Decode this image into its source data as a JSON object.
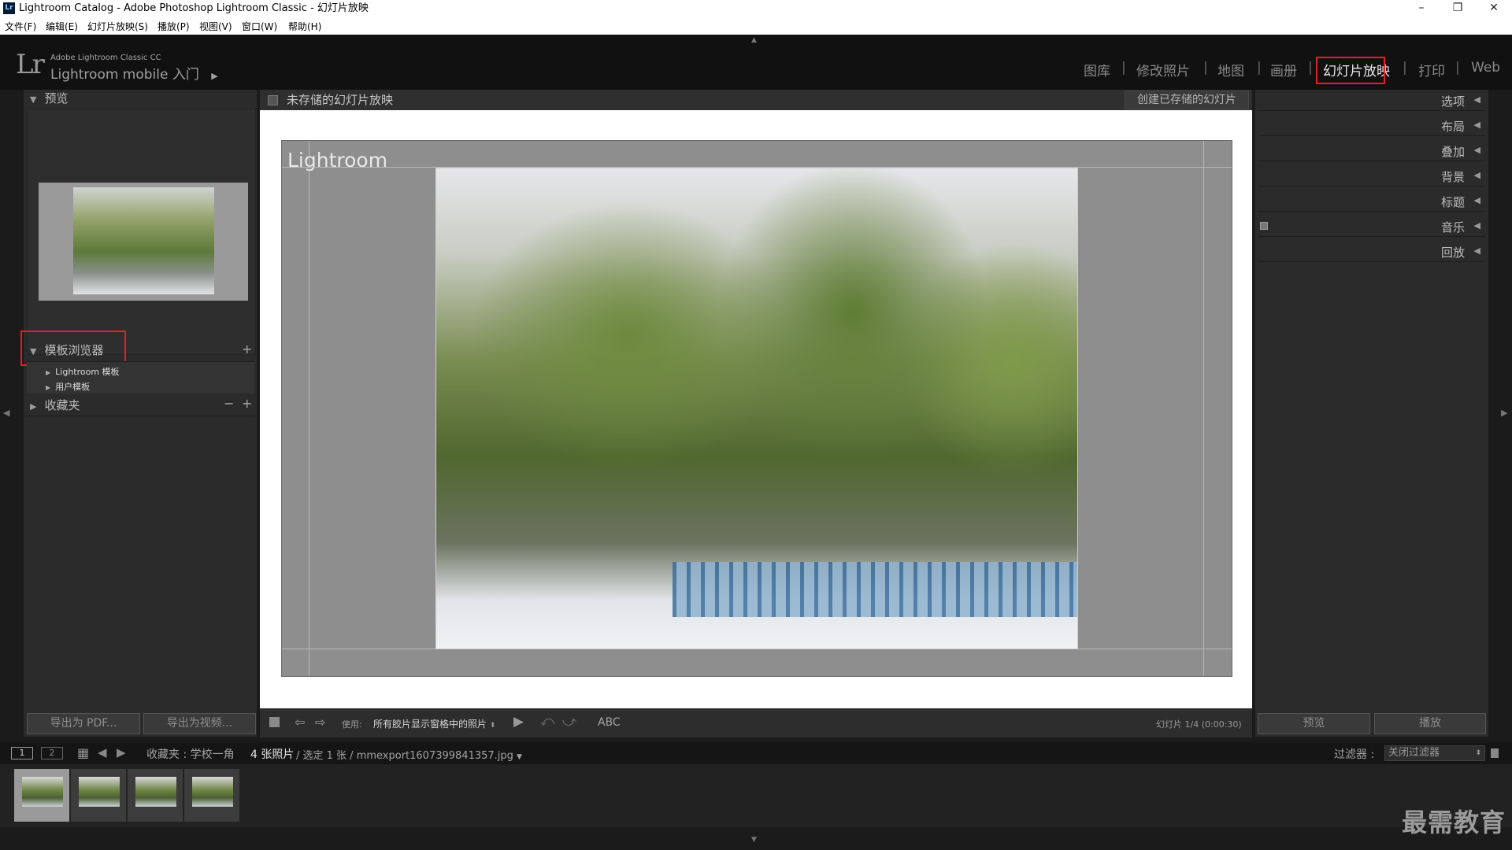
{
  "window": {
    "app_badge": "Lr",
    "title": "Lightroom Catalog - Adobe Photoshop Lightroom Classic - 幻灯片放映",
    "minimize": "–",
    "restore": "❐",
    "close": "✕"
  },
  "menu": [
    "文件(F)",
    "编辑(E)",
    "幻灯片放映(S)",
    "播放(P)",
    "视图(V)",
    "窗口(W)",
    "帮助(H)"
  ],
  "brand": {
    "logo": "Lr",
    "small": "Adobe Lightroom Classic CC",
    "mobile": "Lightroom mobile 入门",
    "arrow": "▶"
  },
  "modules": {
    "items": [
      "图库",
      "修改照片",
      "地图",
      "画册",
      "幻灯片放映",
      "打印",
      "Web"
    ],
    "active": "幻灯片放映",
    "separator": "|"
  },
  "left_panel": {
    "preview_title": "预览",
    "template_browser_title": "模板浏览器",
    "template_items": [
      "Lightroom 模板",
      "用户模板"
    ],
    "collections_title": "收藏夹",
    "add": "+",
    "minus": "−",
    "plus": "+",
    "export_pdf": "导出为 PDF...",
    "export_video": "导出为视频..."
  },
  "center": {
    "slideshow_title": "未存储的幻灯片放映",
    "create_saved": "创建已存储的幻灯片",
    "slide_identity_text": "Lightroom",
    "use_label": "使用:",
    "use_value": "所有胶片显示窗格中的照片",
    "abc": "ABC",
    "slide_counter": "幻灯片 1/4 (0:00:30)"
  },
  "right_panel": {
    "sections": [
      "选项",
      "布局",
      "叠加",
      "背景",
      "标题",
      "音乐",
      "回放"
    ],
    "preview_btn": "预览",
    "play_btn": "播放"
  },
  "filmbar": {
    "page1": "1",
    "page2": "2",
    "collection": "收藏夹 : 学校一角",
    "count": "4 张照片",
    "selection": "/ 选定 1 张 / mmexport1607399841357.jpg",
    "filter_label": "过滤器 :",
    "filter_value": "关闭过滤器"
  },
  "filmstrip": {
    "thumbnail_count": 4,
    "selected_index": 0
  },
  "watermark": "最需教育",
  "colors": {
    "highlight_box": "#e0212b",
    "panel_bg": "#2b2b2b",
    "stage_bg": "#ffffff",
    "slide_bg": "#8e8e8e"
  }
}
